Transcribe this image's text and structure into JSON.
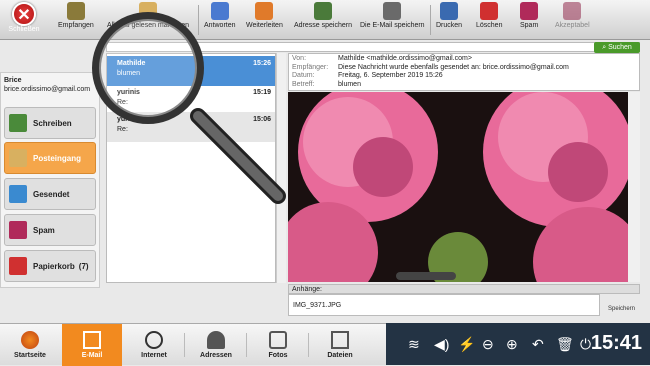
{
  "toolbar": {
    "quit_label": "Schließen",
    "buttons": [
      {
        "label": "Empfangen",
        "icon": "inbox-icon"
      },
      {
        "label": "Alle als gelesen markieren",
        "icon": "mark-read-icon"
      },
      {
        "label": "Antworten",
        "icon": "reply-icon"
      },
      {
        "label": "Weiterleiten",
        "icon": "forward-icon"
      },
      {
        "label": "Adresse speichern",
        "icon": "address-book-icon"
      },
      {
        "label": "Die E-Mail speichern",
        "icon": "save-mail-icon"
      },
      {
        "label": "Drucken",
        "icon": "printer-icon"
      },
      {
        "label": "Löschen",
        "icon": "trash-icon"
      },
      {
        "label": "Spam",
        "icon": "spam-icon"
      },
      {
        "label": "Akzeptabel",
        "icon": "accept-icon"
      }
    ]
  },
  "search": {
    "button_label": "Suchen",
    "placeholder": ""
  },
  "account": {
    "name": "Brice",
    "email": "brice.ordissimo@gmail.com"
  },
  "folders": [
    {
      "label": "Schreiben",
      "count": ""
    },
    {
      "label": "Posteingang",
      "count": ""
    },
    {
      "label": "Gesendet",
      "count": ""
    },
    {
      "label": "Spam",
      "count": ""
    },
    {
      "label": "Papierkorb",
      "count": "(7)"
    }
  ],
  "messages": [
    {
      "from": "Mathilde",
      "subject": "blumen",
      "time": "15:26"
    },
    {
      "from": "yurinis",
      "subject": "Re:",
      "time": "15:19"
    },
    {
      "from": "yurinis",
      "subject": "Re:",
      "time": "15:06"
    }
  ],
  "header": {
    "from_label": "Von:",
    "from_value": "Mathilde <mathilde.ordissimo@gmail.com>",
    "to_label": "Empfänger:",
    "to_value": "Diese Nachricht wurde ebenfalls gesendet an: brice.ordissimo@gmail.com",
    "date_label": "Datum:",
    "date_value": "Freitag, 6. September 2019 15:26",
    "subject_label": "Betreff:",
    "subject_value": "blumen"
  },
  "attachments": {
    "label": "Anhänge:",
    "file": "IMG_9371.JPG",
    "save_label": "Speichern"
  },
  "taskbar": {
    "items": [
      "Startseite",
      "E-Mail",
      "Internet",
      "Adressen",
      "Fotos",
      "Dateien"
    ],
    "clock": "15:41"
  },
  "colors": {
    "accent": "#f28a1f",
    "selected": "#4a8fd6",
    "search": "#4a9a2a"
  }
}
